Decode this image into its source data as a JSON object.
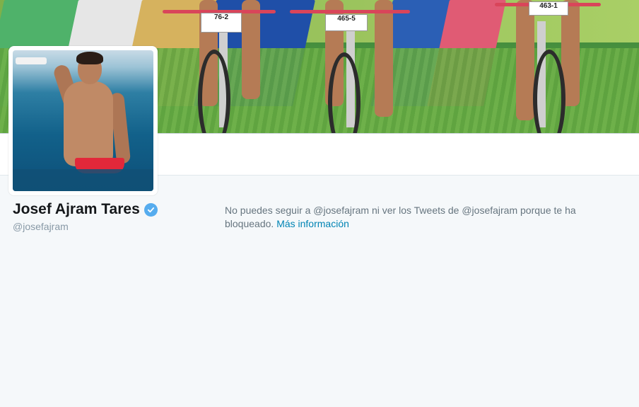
{
  "profile": {
    "name": "Josef Ajram Tares",
    "handle": "@josefajram",
    "verified": true
  },
  "banner": {
    "race_plates": [
      "76-2",
      "465-5",
      "463-1"
    ]
  },
  "blocked_notice": {
    "message": "No puedes seguir a @josefajram ni ver los Tweets de @josefajram porque te ha bloqueado.",
    "link_label": "Más información"
  },
  "colors": {
    "page_bg": "#f5f8fa",
    "link": "#0084b4",
    "verified_badge": "#55acee",
    "name_text": "#14171a",
    "muted_text": "#66757f"
  },
  "icons": {
    "verified": "verified-badge-icon"
  }
}
